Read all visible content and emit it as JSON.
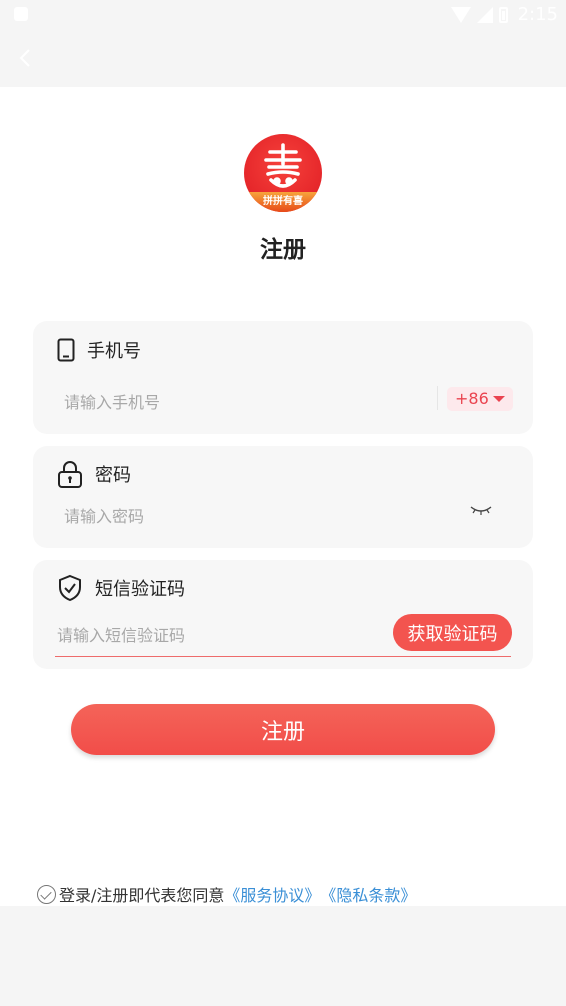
{
  "status_bar": {
    "time": "2:15"
  },
  "logo": {
    "band_text": "拼拼有喜"
  },
  "page_title": "注册",
  "phone": {
    "label": "手机号",
    "placeholder": "请输入手机号",
    "country_code": "+86"
  },
  "password": {
    "label": "密码",
    "placeholder": "请输入密码"
  },
  "sms": {
    "label": "短信验证码",
    "placeholder": "请输入短信验证码",
    "get_code_label": "获取验证码"
  },
  "register_button": "注册",
  "agreement": {
    "prefix": "登录/注册即代表您同意",
    "service_link": "《服务协议》",
    "privacy_link": "《隐私条款》"
  },
  "colors": {
    "accent": "#f24d49",
    "link": "#3a8fd6"
  },
  "icons": [
    "back-icon",
    "phone-icon",
    "lock-icon",
    "shield-check-icon",
    "eye-closed-icon",
    "dropdown-caret-icon",
    "check-circle-icon"
  ]
}
